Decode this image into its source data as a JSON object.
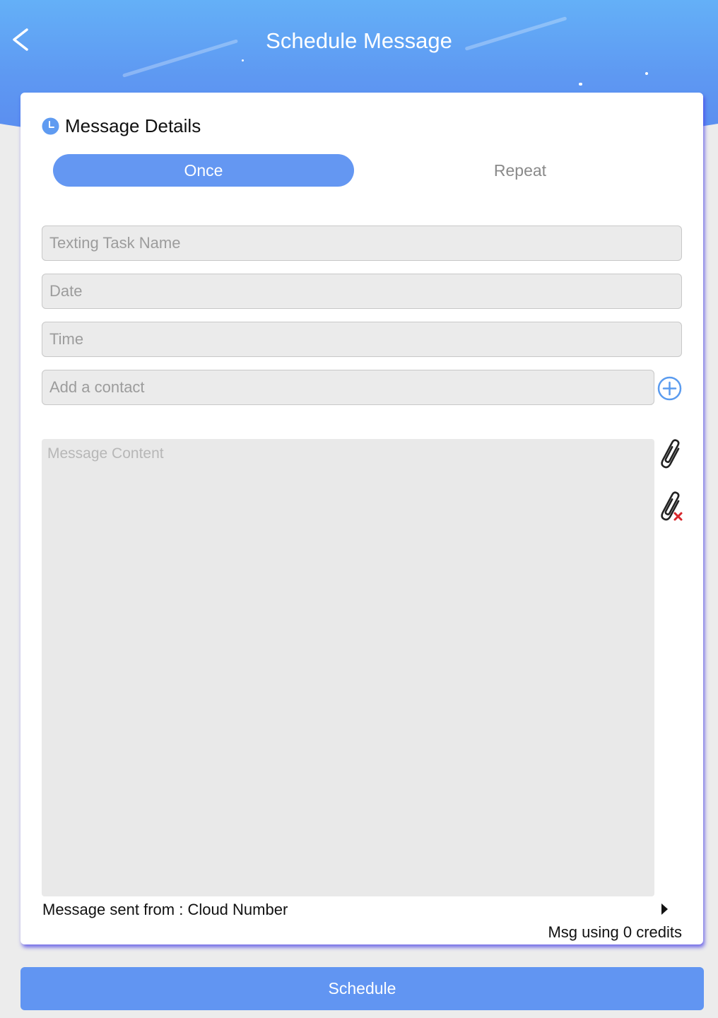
{
  "header": {
    "title": "Schedule Message",
    "back_icon": "chevron-left-icon"
  },
  "section": {
    "title": "Message Details",
    "icon": "clock-icon"
  },
  "frequency": {
    "options": [
      "Once",
      "Repeat"
    ],
    "selected": "Once"
  },
  "form": {
    "task_name_placeholder": "Texting Task Name",
    "date_placeholder": "Date",
    "time_placeholder": "Time",
    "contact_placeholder": "Add a contact",
    "message_placeholder": "Message Content"
  },
  "icons": {
    "add_contact": "plus-circle-icon",
    "attach": "paperclip-icon",
    "remove_attachment": "paperclip-remove-icon",
    "sender_arrow": "caret-right-icon"
  },
  "footer": {
    "sent_from_label": "Message sent from :",
    "sent_from_value": "Cloud Number",
    "credits": "Msg using 0 credits"
  },
  "schedule_button": "Schedule",
  "colors": {
    "accent": "#6195f2",
    "header_top": "#64b0f7",
    "field_bg": "#ebebeb",
    "remove_red": "#d7262b"
  }
}
